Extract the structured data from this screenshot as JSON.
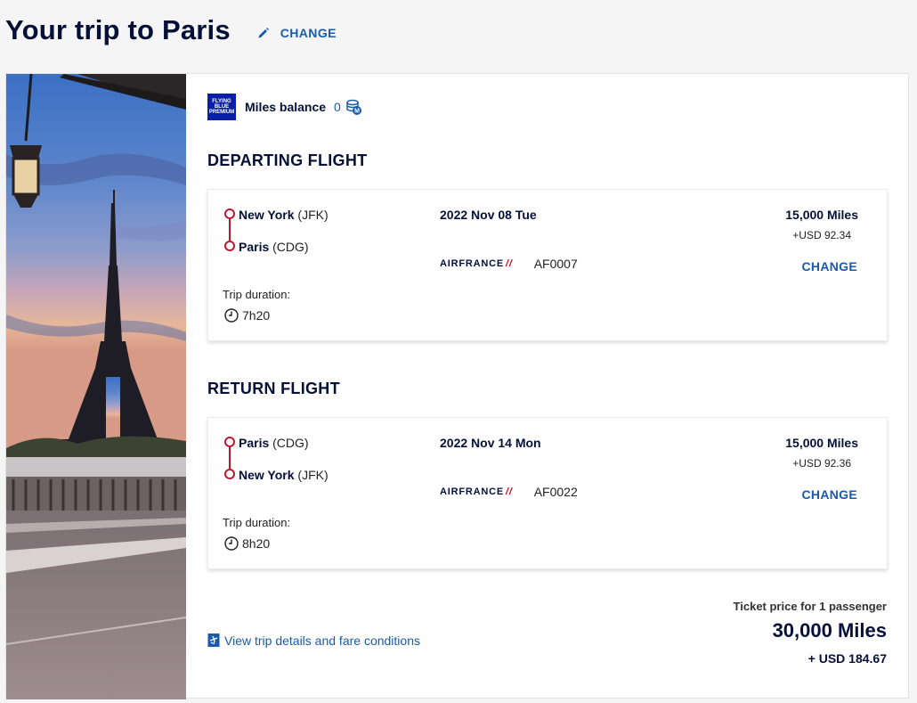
{
  "header": {
    "title": "Your trip to Paris",
    "change_label": "CHANGE"
  },
  "miles_balance": {
    "logo_lines": [
      "FLYING",
      "BLUE",
      "PREMIUM"
    ],
    "label": "Miles balance",
    "value": "0"
  },
  "departing": {
    "section_title": "DEPARTING FLIGHT",
    "origin_city": "New York",
    "origin_code": "(JFK)",
    "destination_city": "Paris",
    "destination_code": "(CDG)",
    "date": "2022 Nov 08 Tue",
    "airline": "AIRFRANCE",
    "flight_number": "AF0007",
    "miles": "15,000 Miles",
    "usd": "+USD 92.34",
    "change_label": "CHANGE",
    "duration_label": "Trip duration:",
    "duration": "7h20"
  },
  "return": {
    "section_title": "RETURN FLIGHT",
    "origin_city": "Paris",
    "origin_code": "(CDG)",
    "destination_city": "New York",
    "destination_code": "(JFK)",
    "date": "2022 Nov 14 Mon",
    "airline": "AIRFRANCE",
    "flight_number": "AF0022",
    "miles": "15,000 Miles",
    "usd": "+USD 92.36",
    "change_label": "CHANGE",
    "duration_label": "Trip duration:",
    "duration": "8h20"
  },
  "footer": {
    "details_link": "View trip details and fare conditions",
    "ticket_label": "Ticket price for 1 passenger",
    "total_miles": "30,000 Miles",
    "total_usd": "+ USD 184.67"
  },
  "colors": {
    "accent": "#1a5aad",
    "navy": "#051039",
    "route": "#c0162d",
    "brand_red": "#d0021b"
  }
}
